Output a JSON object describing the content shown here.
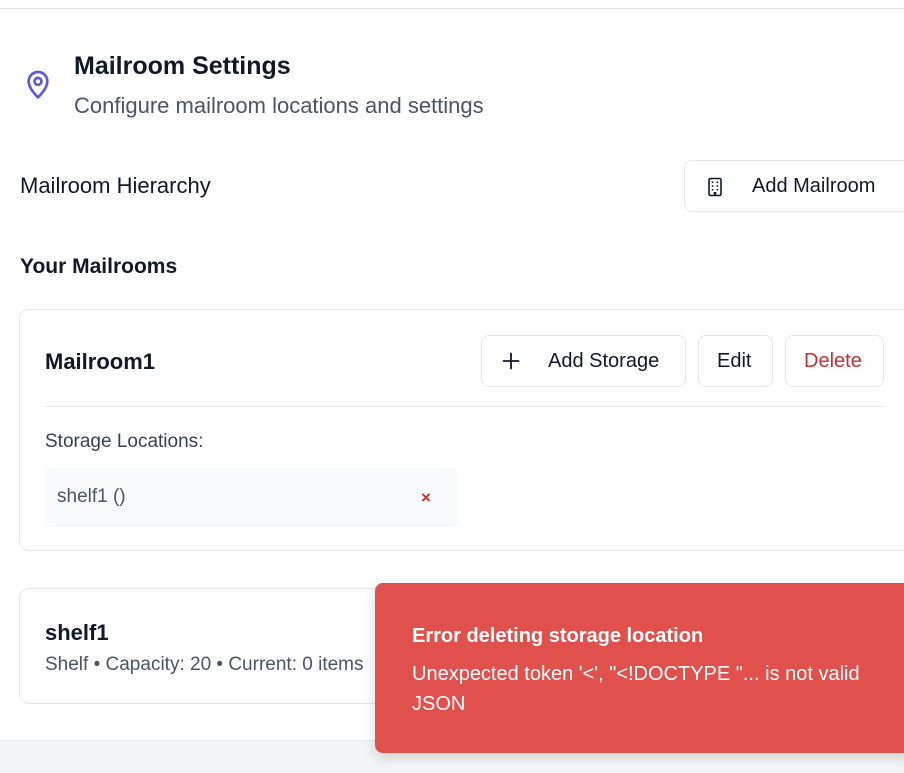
{
  "header": {
    "title": "Mailroom Settings",
    "subtitle": "Configure mailroom locations and settings",
    "icon": "map-pin-icon",
    "icon_color": "#5b5bd6"
  },
  "hierarchy": {
    "title": "Mailroom Hierarchy",
    "add_mailroom_label": "Add Mailroom",
    "add_mailroom_icon": "building-icon"
  },
  "mailrooms_section": {
    "title": "Your Mailrooms"
  },
  "mailroom": {
    "name": "Mailroom1",
    "add_storage_label": "Add Storage",
    "edit_label": "Edit",
    "delete_label": "Delete",
    "storage_heading": "Storage Locations:",
    "storage_items": [
      {
        "name": "shelf1 ()",
        "remove_symbol": "×"
      }
    ]
  },
  "storage_detail": {
    "name": "shelf1",
    "meta": "Shelf • Capacity: 20 • Current: 0 items"
  },
  "toast": {
    "title": "Error deleting storage location",
    "message": "Unexpected token '<', \"<!DOCTYPE \"... is not valid JSON",
    "color": "#e0504d"
  },
  "colors": {
    "danger": "#c53030",
    "border": "#e5e7eb"
  }
}
